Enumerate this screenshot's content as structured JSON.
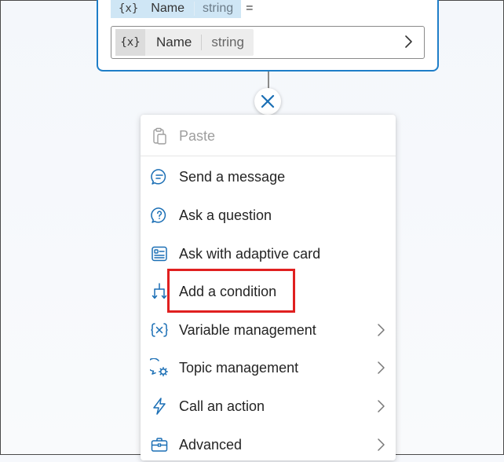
{
  "node": {
    "assign_token": {
      "icon": "{x}",
      "name": "Name",
      "type": "string",
      "operator": "="
    },
    "value_field": {
      "icon": "{x}",
      "name": "Name",
      "type": "string"
    }
  },
  "menu": {
    "items": [
      {
        "label": "Paste",
        "icon": "clipboard-icon",
        "disabled": true
      },
      {
        "label": "Send a message",
        "icon": "chat-bubble-icon"
      },
      {
        "label": "Ask a question",
        "icon": "question-bubble-icon"
      },
      {
        "label": "Ask with adaptive card",
        "icon": "adaptive-card-icon"
      },
      {
        "label": "Add a condition",
        "icon": "branch-icon",
        "highlighted": true
      },
      {
        "label": "Variable management",
        "icon": "variable-icon",
        "submenu": true
      },
      {
        "label": "Topic management",
        "icon": "topic-settings-icon",
        "submenu": true
      },
      {
        "label": "Call an action",
        "icon": "lightning-icon",
        "submenu": true
      },
      {
        "label": "Advanced",
        "icon": "briefcase-icon",
        "submenu": true
      }
    ]
  },
  "colors": {
    "accent": "#1e7ec8",
    "icon_blue": "#1b6fb5",
    "highlight_red": "#e02020"
  }
}
